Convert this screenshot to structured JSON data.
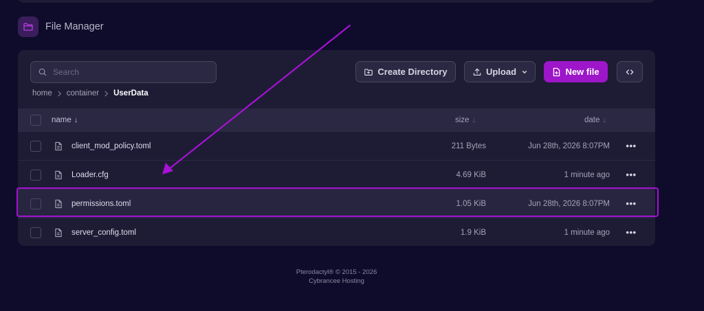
{
  "page": {
    "title": "File Manager"
  },
  "toolbar": {
    "search_placeholder": "Search",
    "create_directory": "Create Directory",
    "upload": "Upload",
    "new_file": "New file"
  },
  "breadcrumb": [
    "home",
    "container",
    "UserData"
  ],
  "table": {
    "headers": {
      "name": "name",
      "size": "size",
      "date": "date"
    },
    "sort_indicator": "↓",
    "rows": [
      {
        "name": "client_mod_policy.toml",
        "size": "211 Bytes",
        "date": "Jun 28th, 2026 8:07PM"
      },
      {
        "name": "Loader.cfg",
        "size": "4.69 KiB",
        "date": "1 minute ago"
      },
      {
        "name": "permissions.toml",
        "size": "1.05 KiB",
        "date": "Jun 28th, 2026 8:07PM"
      },
      {
        "name": "server_config.toml",
        "size": "1.9 KiB",
        "date": "1 minute ago"
      }
    ],
    "row_menu": "•••"
  },
  "footer": {
    "line1": "Pterodactyl® © 2015 - 2026",
    "line2": "Cybrancee Hosting"
  },
  "colors": {
    "background": "#0e0c2a",
    "panel": "#1e1c35",
    "accent": "#9d16c9",
    "annotation": "#a811d6"
  },
  "icons": {
    "header": "folder-icon",
    "search": "search-icon",
    "create_directory": "folder-plus-icon",
    "upload": "upload-icon",
    "new_file": "file-plus-icon",
    "code": "code-icon",
    "file": "file-text-icon"
  }
}
